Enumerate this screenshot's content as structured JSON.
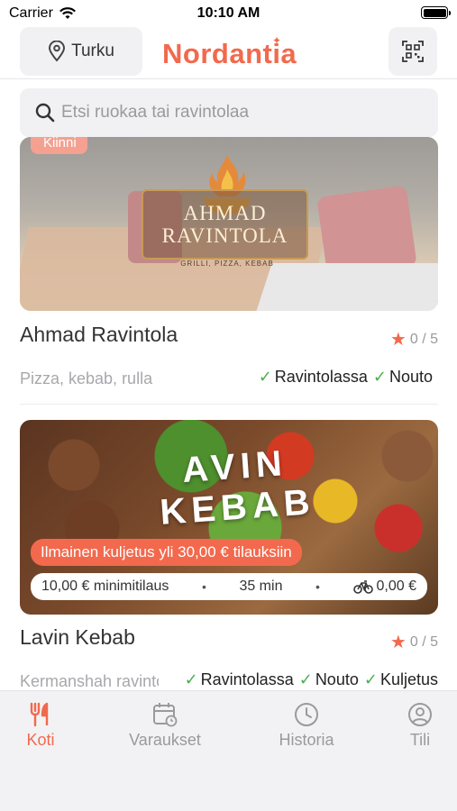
{
  "status_bar": {
    "carrier": "Carrier",
    "time": "10:10 AM"
  },
  "header": {
    "location": "Turku",
    "brand": "Nordantia"
  },
  "search": {
    "placeholder": "Etsi ruokaa tai ravintolaa"
  },
  "restaurants": [
    {
      "status_badge": "Kiinni",
      "sign_name": "AHMAD RAVINTOLA",
      "sign_subtitle": "GRILLI, PIZZA, KEBAB",
      "name": "Ahmad Ravintola",
      "rating": "0 / 5",
      "description": "Pizza, kebab, rulla",
      "services": [
        "Ravintolassa",
        "Nouto"
      ]
    },
    {
      "logo_text": "AVIN KEBAB",
      "promo": "Ilmainen kuljetus yli 30,00 € tilauksiin",
      "min_order": "10,00 € minimitilaus",
      "delivery_time": "35 min",
      "delivery_fee": "0,00 €",
      "name": "Lavin Kebab",
      "rating": "0 / 5",
      "description": "Kermanshah ravintola",
      "services": [
        "Ravintolassa",
        "Nouto",
        "Kuljetus"
      ]
    }
  ],
  "tabbar": {
    "tabs": [
      {
        "label": "Koti",
        "icon": "fork-knife-icon",
        "active": true
      },
      {
        "label": "Varaukset",
        "icon": "calendar-icon",
        "active": false
      },
      {
        "label": "Historia",
        "icon": "clock-icon",
        "active": false
      },
      {
        "label": "Tili",
        "icon": "user-icon",
        "active": false
      }
    ]
  },
  "colors": {
    "accent": "#f2694d",
    "check": "#4caf50",
    "muted": "#9a9a9e"
  }
}
